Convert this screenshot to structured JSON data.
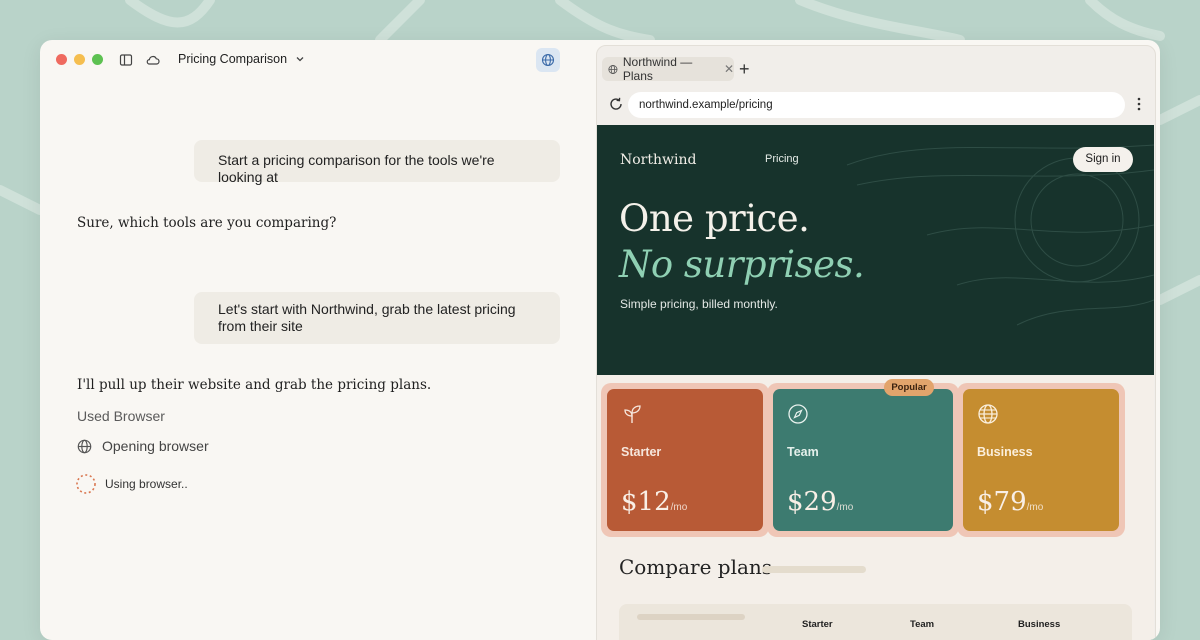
{
  "window": {
    "doc_title": "Pricing Comparison"
  },
  "chat": {
    "messages": [
      {
        "role": "user",
        "text": "Start a pricing comparison for the tools we're looking at"
      },
      {
        "role": "assistant",
        "text": "Sure, which tools are you comparing?"
      },
      {
        "role": "user",
        "text": "Let's start with Northwind, grab the latest pricing from their site"
      },
      {
        "role": "assistant",
        "text": "I'll pull up their website and grab the pricing plans."
      }
    ],
    "tool_heading": "Used Browser",
    "tool_step": "Opening browser",
    "tool_status": "Using browser.."
  },
  "browser": {
    "tab_title": "Northwind — Plans",
    "url": "northwind.example/pricing"
  },
  "site": {
    "logo": "Northwind",
    "nav_pricing": "Pricing",
    "signin": "Sign in",
    "headline_line1": "One price.",
    "headline_line2": "No surprises.",
    "subhead": "Simple pricing, billed monthly.",
    "plans": [
      {
        "name": "Starter",
        "price": "$12",
        "per": "/mo",
        "icon": "sprout-icon",
        "color": "#b85a36"
      },
      {
        "name": "Team",
        "price": "$29",
        "per": "/mo",
        "icon": "compass-icon",
        "color": "#3d7b70",
        "badge": "Popular"
      },
      {
        "name": "Business",
        "price": "$79",
        "per": "/mo",
        "icon": "globe-icon",
        "color": "#c58d30"
      }
    ],
    "compare_title": "Compare plans",
    "table_columns": [
      "Starter",
      "Team",
      "Business"
    ]
  }
}
